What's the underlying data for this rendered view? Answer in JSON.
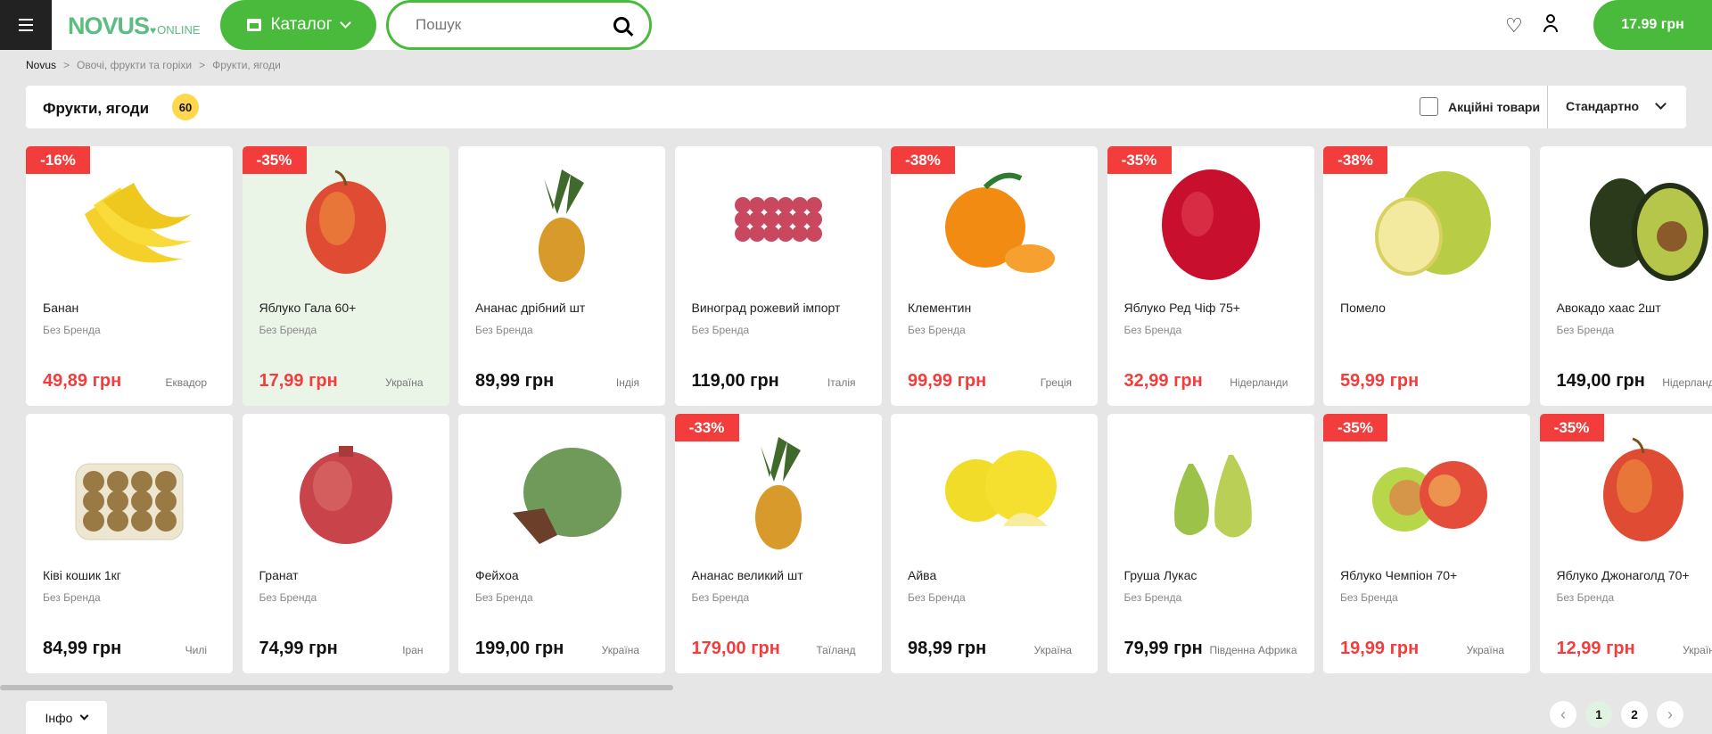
{
  "header": {
    "logo": "NOVUS",
    "logo_suffix": "ONLINE",
    "catalog_label": "Каталог",
    "search_placeholder": "Пошук",
    "cart_total": "17.99 грн"
  },
  "breadcrumb": [
    "Novus",
    "Овочі, фрукти та горіхи",
    "Фрукти, ягоди"
  ],
  "category": {
    "title": "Фрукти, ягоди",
    "count": "60",
    "promo_label": "Акційні товари",
    "sort_label": "Стандартно"
  },
  "colors": {
    "accent": "#4aba3c",
    "sale": "#f33d3d",
    "badge_count": "#ffd84d"
  },
  "products": [
    [
      {
        "name": "Банан",
        "brand": "Без Бренда",
        "price": "49,89 грн",
        "country": "Еквадор",
        "discount": "-16%",
        "sale": true,
        "image": "banana"
      },
      {
        "name": "Яблуко Гала 60+",
        "brand": "Без Бренда",
        "price": "17,99 грн",
        "country": "Україна",
        "discount": "-35%",
        "sale": true,
        "image": "apple-red",
        "highlighted": true
      },
      {
        "name": "Ананас дрібний шт",
        "brand": "Без Бренда",
        "price": "89,99 грн",
        "country": "Індія",
        "image": "pineapple"
      },
      {
        "name": "Виноград рожевий імпорт",
        "brand": "Без Бренда",
        "price": "119,00 грн",
        "country": "Італія",
        "image": "grapes"
      },
      {
        "name": "Клементин",
        "brand": "Без Бренда",
        "price": "99,99 грн",
        "country": "Греція",
        "discount": "-38%",
        "sale": true,
        "image": "clementine"
      },
      {
        "name": "Яблуко Ред Чіф 75+",
        "brand": "Без Бренда",
        "price": "32,99 грн",
        "country": "Нідерланди",
        "discount": "-35%",
        "sale": true,
        "image": "apple-dark"
      },
      {
        "name": "Помело",
        "brand": "",
        "price": "59,99 грн",
        "country": "",
        "discount": "-38%",
        "sale": true,
        "image": "pomelo"
      },
      {
        "name": "Авокадо хаас 2шт",
        "brand": "Без Бренда",
        "price": "149,00 грн",
        "country": "Нідерланди",
        "image": "avocado"
      }
    ],
    [
      {
        "name": "Ківі кошик 1кг",
        "brand": "Без Бренда",
        "price": "84,99 грн",
        "country": "Чилі",
        "image": "kiwi"
      },
      {
        "name": "Гранат",
        "brand": "Без Бренда",
        "price": "74,99 грн",
        "country": "Іран",
        "image": "pomegranate"
      },
      {
        "name": "Фейхоа",
        "brand": "Без Бренда",
        "price": "199,00 грн",
        "country": "Україна",
        "image": "feijoa"
      },
      {
        "name": "Ананас великий шт",
        "brand": "Без Бренда",
        "price": "179,00 грн",
        "country": "Таїланд",
        "discount": "-33%",
        "sale": true,
        "image": "pineapple"
      },
      {
        "name": "Айва",
        "brand": "Без Бренда",
        "price": "98,99 грн",
        "country": "Україна",
        "image": "quince"
      },
      {
        "name": "Груша Лукас",
        "brand": "Без Бренда",
        "price": "79,99 грн",
        "country": "Південна Африка",
        "image": "pear"
      },
      {
        "name": "Яблуко Чемпіон 70+",
        "brand": "Без Бренда",
        "price": "19,99 грн",
        "country": "Україна",
        "discount": "-35%",
        "sale": true,
        "image": "apple-green"
      },
      {
        "name": "Яблуко Джонаголд 70+",
        "brand": "Без Бренда",
        "price": "12,99 грн",
        "country": "Україна",
        "discount": "-35%",
        "sale": true,
        "image": "apple-red"
      }
    ]
  ],
  "footer": {
    "info_label": "Інфо",
    "pages": [
      "1",
      "2"
    ],
    "current_page": "1"
  }
}
